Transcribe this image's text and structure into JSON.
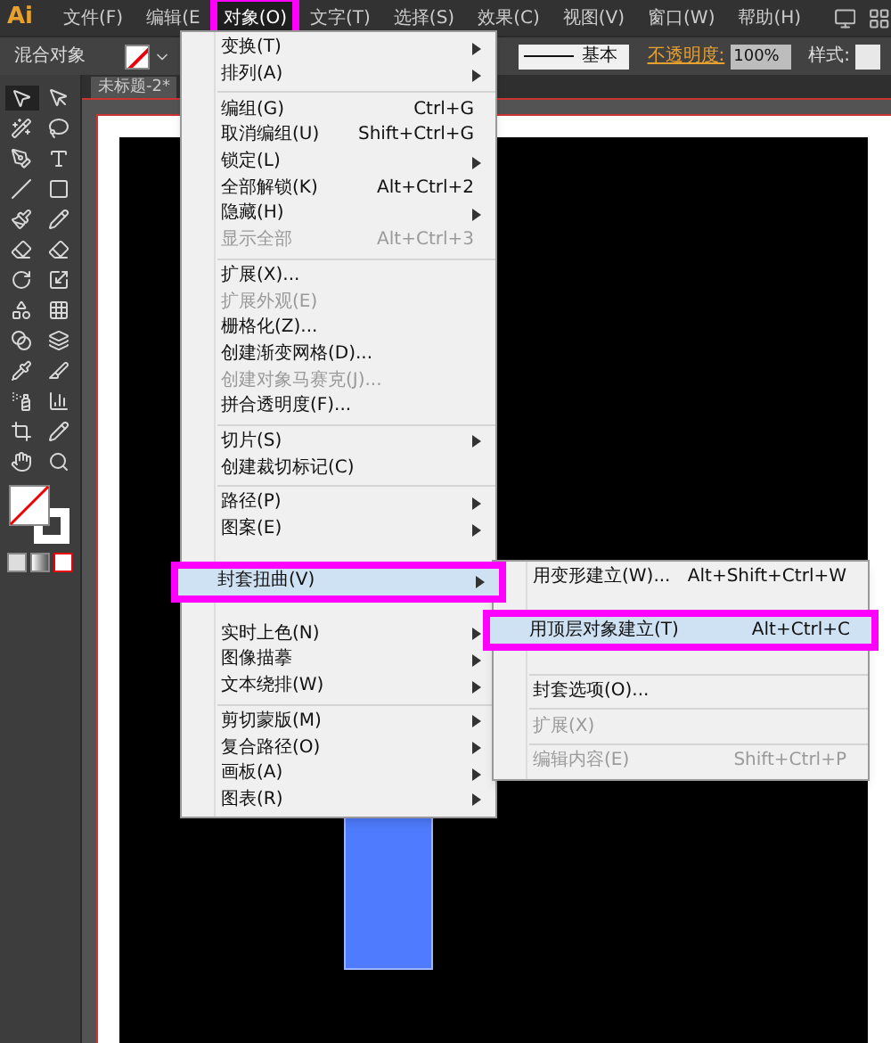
{
  "app_logo": "Ai",
  "menu_bar": [
    {
      "label": "文件(F)",
      "selected": false,
      "annotated": false
    },
    {
      "label": "编辑(E",
      "selected": false,
      "annotated": false
    },
    {
      "label": "对象(O)",
      "selected": true,
      "annotated": true
    },
    {
      "label": "文字(T)",
      "selected": false,
      "annotated": false
    },
    {
      "label": "选择(S)",
      "selected": false,
      "annotated": false
    },
    {
      "label": "效果(C)",
      "selected": false,
      "annotated": false
    },
    {
      "label": "视图(V)",
      "selected": false,
      "annotated": false
    },
    {
      "label": "窗口(W)",
      "selected": false,
      "annotated": false
    },
    {
      "label": "帮助(H)",
      "selected": false,
      "annotated": false
    }
  ],
  "control_bar": {
    "selection_label": "混合对象",
    "stroke_style": "基本",
    "opacity_label": "不透明度:",
    "opacity_value": "100%",
    "style_label": "样式:"
  },
  "document_tab": "未标题-2*",
  "object_menu": [
    [
      {
        "kind": "item",
        "label": "变换(T)",
        "disabled": false,
        "submenu": true,
        "selected": false,
        "annotated": false
      },
      {
        "kind": "item",
        "label": "排列(A)",
        "disabled": false,
        "submenu": true,
        "selected": false,
        "annotated": false
      }
    ],
    [
      {
        "kind": "item",
        "label": "编组(G)",
        "shortcut": "Ctrl+G",
        "disabled": false,
        "submenu": false,
        "selected": false,
        "annotated": false
      },
      {
        "kind": "item",
        "label": "取消编组(U)",
        "shortcut": "Shift+Ctrl+G",
        "disabled": false,
        "submenu": false,
        "selected": false,
        "annotated": false
      },
      {
        "kind": "item",
        "label": "锁定(L)",
        "disabled": false,
        "submenu": true,
        "selected": false,
        "annotated": false
      },
      {
        "kind": "item",
        "label": "全部解锁(K)",
        "shortcut": "Alt+Ctrl+2",
        "disabled": false,
        "submenu": false,
        "selected": false,
        "annotated": false
      },
      {
        "kind": "item",
        "label": "隐藏(H)",
        "disabled": false,
        "submenu": true,
        "selected": false,
        "annotated": false
      },
      {
        "kind": "item",
        "label": "显示全部",
        "shortcut": "Alt+Ctrl+3",
        "disabled": true,
        "submenu": false,
        "selected": false,
        "annotated": false
      }
    ],
    [
      {
        "kind": "item",
        "label": "扩展(X)...",
        "disabled": false,
        "submenu": false,
        "selected": false,
        "annotated": false
      },
      {
        "kind": "item",
        "label": "扩展外观(E)",
        "disabled": true,
        "submenu": false,
        "selected": false,
        "annotated": false
      },
      {
        "kind": "item",
        "label": "栅格化(Z)...",
        "disabled": false,
        "submenu": false,
        "selected": false,
        "annotated": false
      },
      {
        "kind": "item",
        "label": "创建渐变网格(D)...",
        "disabled": false,
        "submenu": false,
        "selected": false,
        "annotated": false
      },
      {
        "kind": "item",
        "label": "创建对象马赛克(J)...",
        "disabled": true,
        "submenu": false,
        "selected": false,
        "annotated": false
      },
      {
        "kind": "item",
        "label": "拼合透明度(F)...",
        "disabled": false,
        "submenu": false,
        "selected": false,
        "annotated": false
      }
    ],
    [
      {
        "kind": "item",
        "label": "切片(S)",
        "disabled": false,
        "submenu": true,
        "selected": false,
        "annotated": false
      },
      {
        "kind": "item",
        "label": "创建裁切标记(C)",
        "disabled": false,
        "submenu": false,
        "selected": false,
        "annotated": false
      }
    ],
    [
      {
        "kind": "item",
        "label": "路径(P)",
        "disabled": false,
        "submenu": true,
        "selected": false,
        "annotated": false
      },
      {
        "kind": "item",
        "label": "图案(E)",
        "disabled": false,
        "submenu": true,
        "selected": false,
        "annotated": false
      },
      {
        "kind": "covered"
      },
      {
        "kind": "item",
        "label": "封套扭曲(V)",
        "disabled": false,
        "submenu": true,
        "selected": true,
        "annotated": true
      },
      {
        "kind": "covered"
      },
      {
        "kind": "item",
        "label": "实时上色(N)",
        "disabled": false,
        "submenu": true,
        "selected": false,
        "annotated": false
      },
      {
        "kind": "item",
        "label": "图像描摹",
        "disabled": false,
        "submenu": true,
        "selected": false,
        "annotated": false
      },
      {
        "kind": "item",
        "label": "文本绕排(W)",
        "disabled": false,
        "submenu": true,
        "selected": false,
        "annotated": false
      }
    ],
    [
      {
        "kind": "item",
        "label": "剪切蒙版(M)",
        "disabled": false,
        "submenu": true,
        "selected": false,
        "annotated": false
      },
      {
        "kind": "item",
        "label": "复合路径(O)",
        "disabled": false,
        "submenu": true,
        "selected": false,
        "annotated": false
      },
      {
        "kind": "item",
        "label": "画板(A)",
        "disabled": false,
        "submenu": true,
        "selected": false,
        "annotated": false
      },
      {
        "kind": "item",
        "label": "图表(R)",
        "disabled": false,
        "submenu": true,
        "selected": false,
        "annotated": false
      }
    ]
  ],
  "envelope_submenu": [
    [
      {
        "kind": "item",
        "label": "用变形建立(W)...",
        "shortcut": "Alt+Shift+Ctrl+W",
        "disabled": false,
        "selected": false,
        "annotated": false
      },
      {
        "kind": "covered"
      },
      {
        "kind": "item",
        "label": "用顶层对象建立(T)",
        "shortcut": "Alt+Ctrl+C",
        "disabled": false,
        "selected": true,
        "annotated": true
      },
      {
        "kind": "covered"
      }
    ],
    [
      {
        "kind": "item",
        "label": "封套选项(O)...",
        "disabled": false,
        "selected": false,
        "annotated": false
      }
    ],
    [
      {
        "kind": "item",
        "label": "扩展(X)",
        "disabled": true,
        "selected": false,
        "annotated": false
      }
    ],
    [
      {
        "kind": "item",
        "label": "编辑内容(E)",
        "shortcut": "Shift+Ctrl+P",
        "disabled": true,
        "selected": false,
        "annotated": false
      }
    ]
  ]
}
